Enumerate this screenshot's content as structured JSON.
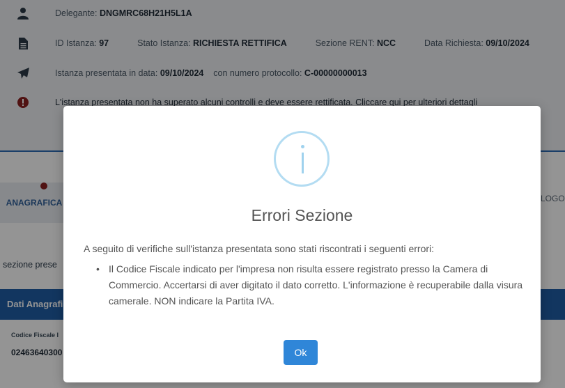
{
  "header": {
    "delegante_label": "Delegante:",
    "delegante_value": "DNGMRC68H21H5L1A",
    "id_label": "ID Istanza:",
    "id_value": "97",
    "stato_label": "Stato Istanza:",
    "stato_value": "RICHIESTA RETTIFICA",
    "sezione_label": "Sezione RENT:",
    "sezione_value": "NCC",
    "data_label": "Data Richiesta:",
    "data_value": "09/10/2024",
    "presentata_label": "Istanza presentata in data:",
    "presentata_value": "09/10/2024",
    "protocollo_label": "con numero protocollo:",
    "protocollo_value": "C-00000000013",
    "warning_text": "L'istanza presentata non ha superato alcuni controlli e deve essere rettificata. Cliccare qui per ulteriori dettagli"
  },
  "tabs": {
    "anagrafica": "ANAGRAFICA",
    "logo": "LOGO"
  },
  "section_text": "sezione prese",
  "blue_bar_title": "Dati Anagrafi",
  "field": {
    "label": "Codice Fiscale I",
    "value": "02463640300"
  },
  "modal": {
    "title": "Errori Sezione",
    "intro": "A seguito di verifiche sull'istanza presentata sono stati riscontrati i seguenti errori:",
    "errors": [
      "Il Codice Fiscale indicato per l'impresa non risulta essere registrato presso la Camera di Commercio. Accertarsi di aver digitato il dato corretto. L'informazione è recuperabile dalla visura camerale. NON indicare la Partita IVA."
    ],
    "ok_label": "Ok"
  },
  "icons": {
    "user": "user-icon",
    "document": "document-icon",
    "send": "paper-plane-icon",
    "error": "exclamation-circle-icon",
    "info": "info-icon"
  },
  "colors": {
    "accent_blue": "#1f5da6",
    "error_red": "#8b1f1f",
    "ok_button": "#2f86d8",
    "info_ring": "#b3dcf2"
  }
}
